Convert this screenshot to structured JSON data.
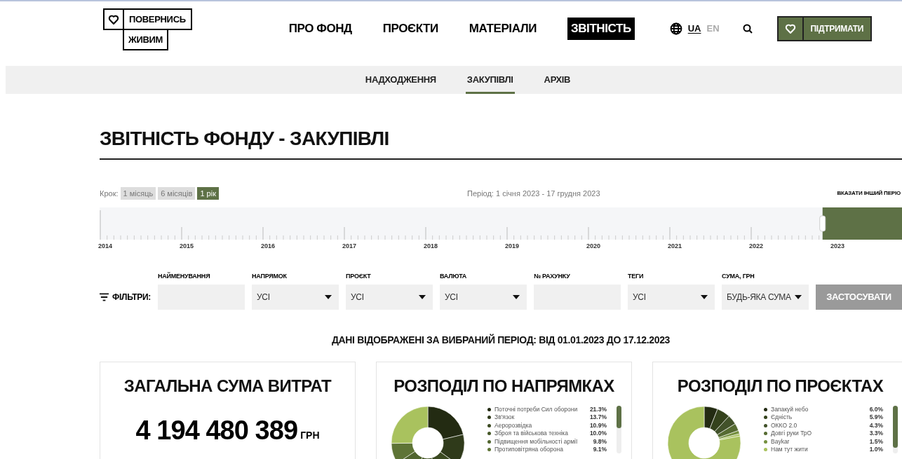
{
  "logo": {
    "line_1": "ПОВЕРНИСЬ",
    "line_2": "ЖИВИМ"
  },
  "nav": [
    {
      "label": "ПРО ФОНД",
      "selected": false
    },
    {
      "label": "ПРОЄКТИ",
      "selected": false
    },
    {
      "label": "МАТЕРІАЛИ",
      "selected": false
    },
    {
      "label": "ЗВІТНІСТЬ",
      "selected": true
    }
  ],
  "languages": [
    {
      "label": "UA",
      "selected": true
    },
    {
      "label": "EN",
      "selected": false
    }
  ],
  "donate_button": "ПІДТРИМАТИ",
  "subnav": [
    {
      "label": "НАДХОДЖЕННЯ",
      "selected": false
    },
    {
      "label": "ЗАКУПІВЛІ",
      "selected": true
    },
    {
      "label": "АРХІВ",
      "selected": false
    }
  ],
  "page_title": "ЗВІТНІСТЬ ФОНДУ - ЗАКУПІВЛІ",
  "timeline": {
    "step_label": "Крок:",
    "steps": [
      {
        "label": "1 місяць",
        "selected": false
      },
      {
        "label": "6 місяців",
        "selected": false
      },
      {
        "label": "1 рік",
        "selected": true
      }
    ],
    "period": "Період: 1 січня 2023 - 17 грудня 2023",
    "other_period_link": "ВКАЗАТИ ІНШИЙ ПЕРІО",
    "level": 0.09,
    "years": [
      "2014",
      "2015",
      "2016",
      "2017",
      "2018",
      "2019",
      "2020",
      "2021",
      "2022",
      "2023"
    ]
  },
  "filters": {
    "label": "ФІЛЬТРИ:",
    "fields": [
      {
        "kind": "text",
        "label": "НАЙМЕНУВАННЯ"
      },
      {
        "kind": "select",
        "label": "НАПРЯМОК",
        "value": "УСІ"
      },
      {
        "kind": "select",
        "label": "ПРОЄКТ",
        "value": "УСІ"
      },
      {
        "kind": "select",
        "label": "ВАЛЮТА",
        "value": "УСІ"
      },
      {
        "kind": "text",
        "label": "№ РАХУНКУ"
      },
      {
        "kind": "select",
        "label": "ТЕГИ",
        "value": "УСІ"
      },
      {
        "kind": "select",
        "label": "СУМА, ГРН",
        "value": "БУДЬ-ЯКА СУМА"
      }
    ],
    "apply_button": {
      "label": "ЗАСТОСУВАТИ",
      "disabled": true
    }
  },
  "period_note": "ДАНІ ВІДОБРАЖЕНІ ЗА ВИБРАНИЙ ПЕРІОД: ВІД 01.01.2023 ДО 17.12.2023",
  "total_card": {
    "title": "ЗАГАЛЬНА СУМА ВИТРАТ",
    "amount": "4 194 480 389",
    "currency": "ГРН"
  },
  "distribution_cards": [
    {
      "title": "РОЗПОДІЛ ПО НАПРЯМКАХ",
      "legend": [
        {
          "label": "Поточні потреби Сил оборони",
          "share": "21.3%",
          "color": "#232b12"
        },
        {
          "label": "Зв'язок",
          "share": "13.7%",
          "color": "#2f3a1a"
        },
        {
          "label": "Аеророзвідка",
          "share": "10.9%",
          "color": "#3b4a21"
        },
        {
          "label": "Зброя та військова техніка",
          "share": "10.0%",
          "color": "#465828"
        },
        {
          "label": "Підвищення мобільності армії",
          "share": "9.8%",
          "color": "#51652f"
        },
        {
          "label": "Протиповітряна оборона",
          "share": "9.1%",
          "color": "#5e7436"
        }
      ]
    },
    {
      "title": "РОЗПОДІЛ ПО ПРОЄКТАХ",
      "legend": [
        {
          "label": "Запакуй небо",
          "share": "6.0%",
          "color": "#232b12"
        },
        {
          "label": "Єдність",
          "share": "5.9%",
          "color": "#34421c"
        },
        {
          "label": "ОККО 2.0",
          "share": "4.3%",
          "color": "#42522a"
        },
        {
          "label": "Довгі руки ТрО",
          "share": "3.3%",
          "color": "#566b32"
        },
        {
          "label": "Baykar",
          "share": "1.5%",
          "color": "#75903f"
        },
        {
          "label": "Нам тут жити",
          "share": "1.0%",
          "color": "#a9c25e"
        }
      ]
    }
  ]
}
